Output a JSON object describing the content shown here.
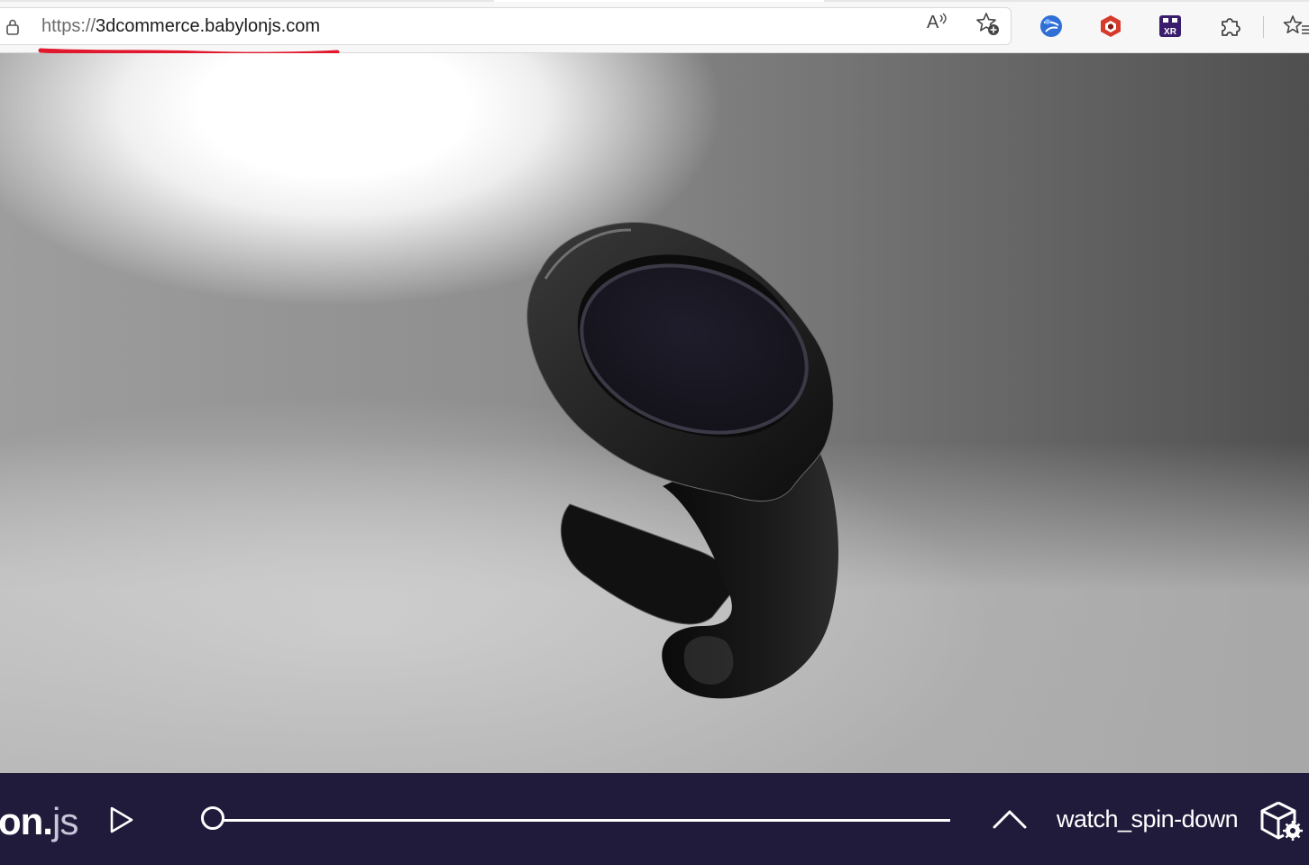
{
  "browser": {
    "url_scheme": "https://",
    "url_host": "3dcommerce.babylonjs.com",
    "icons": {
      "lock": "lock-icon",
      "read_aloud": "read-aloud-icon",
      "add_favorite": "add-favorite-icon",
      "extensions": [
        "globe-extension-icon",
        "hexagon-extension-icon",
        "xr-extension-icon",
        "puzzle-extensions-icon"
      ],
      "favorites": "favorites-icon"
    },
    "read_aloud_glyph": "A",
    "xr_label": "XR"
  },
  "annotation": {
    "color": "#e0192e",
    "type": "red-underline"
  },
  "viewer": {
    "subject": "3d-watch-model",
    "background_colors": [
      "#ffffff",
      "#9d9d9d",
      "#4f4f4f"
    ]
  },
  "player": {
    "logo_bold": "on.",
    "logo_light": "js",
    "animation_name": "watch_spin-down",
    "progress": 0.0,
    "background_color": "#201a3b",
    "icons": {
      "play": "play-icon",
      "expand": "chevron-up-icon",
      "settings": "cube-settings-icon"
    }
  }
}
